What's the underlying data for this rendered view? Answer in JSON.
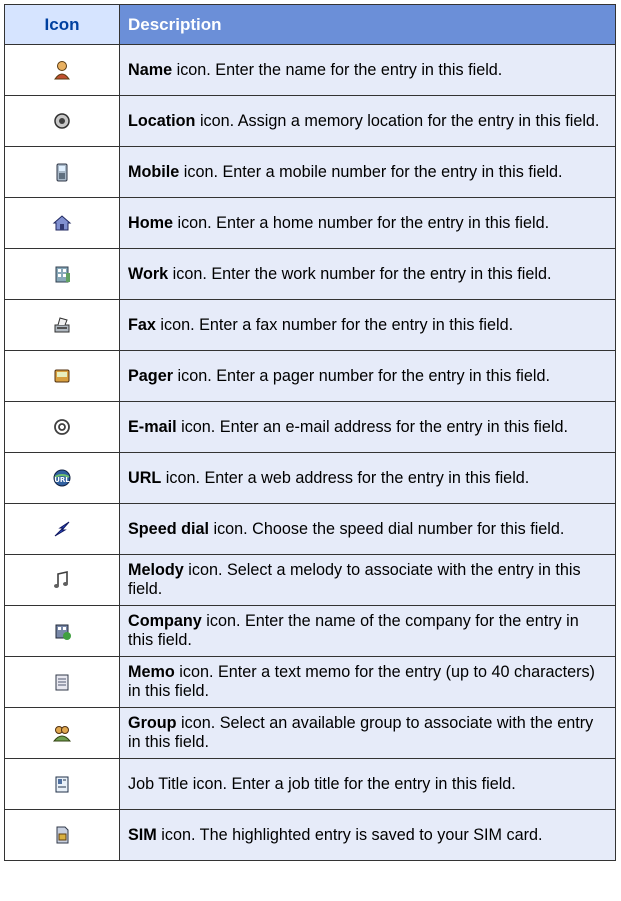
{
  "header": {
    "icon_label": "Icon",
    "description_label": "Description"
  },
  "rows": [
    {
      "icon": "name-icon",
      "name": "Name",
      "text": " icon. Enter the name for the entry in this field."
    },
    {
      "icon": "location-icon",
      "name": "Location",
      "text": " icon. Assign a memory location for the entry in this field."
    },
    {
      "icon": "mobile-icon",
      "name": "Mobile",
      "text": " icon. Enter a mobile number for the entry in this field."
    },
    {
      "icon": "home-icon",
      "name": "Home",
      "text": " icon. Enter a home number for the entry in this field."
    },
    {
      "icon": "work-icon",
      "name": "Work",
      "text": " icon. Enter the work number for the entry in this field."
    },
    {
      "icon": "fax-icon",
      "name": "Fax",
      "text": " icon. Enter a fax number for the entry in this field."
    },
    {
      "icon": "pager-icon",
      "name": "Pager",
      "text": " icon. Enter a pager number for the entry in this field."
    },
    {
      "icon": "email-icon",
      "name": "E-mail",
      "text": " icon. Enter an e-mail address for the entry in this field."
    },
    {
      "icon": "url-icon",
      "name": "URL",
      "text": " icon. Enter a web address for the entry in this field."
    },
    {
      "icon": "speed-dial-icon",
      "name": "Speed dial",
      "text": " icon. Choose the speed dial number for this field."
    },
    {
      "icon": "melody-icon",
      "name": "Melody",
      "text": " icon. Select a melody to associate with the entry in this field."
    },
    {
      "icon": "company-icon",
      "name": "Company",
      "text": " icon. Enter the name of the company for the entry in this field."
    },
    {
      "icon": "memo-icon",
      "name": "Memo",
      "text": " icon. Enter a text memo for the entry (up to 40 characters) in this field."
    },
    {
      "icon": "group-icon",
      "name": "Group",
      "text": " icon. Select an available group to associate with the entry in this field."
    },
    {
      "icon": "job-title-icon",
      "name": "",
      "text": "Job Title icon. Enter a job title for the entry in this field."
    },
    {
      "icon": "sim-icon",
      "name": "SIM",
      "text": " icon. The highlighted entry is saved to your SIM card."
    }
  ]
}
